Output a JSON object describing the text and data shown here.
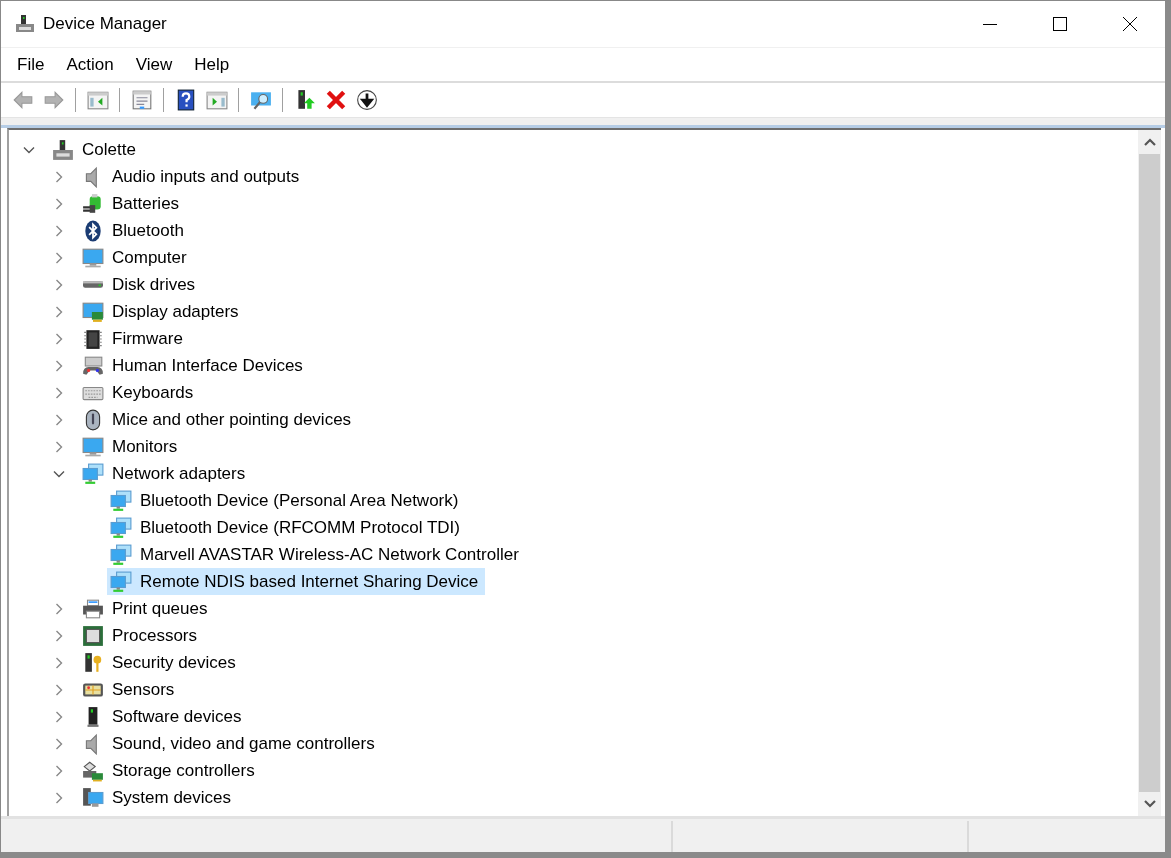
{
  "window": {
    "title": "Device Manager"
  },
  "menu": [
    {
      "label": "File"
    },
    {
      "label": "Action"
    },
    {
      "label": "View"
    },
    {
      "label": "Help"
    }
  ],
  "toolbar": [
    {
      "kind": "back",
      "disabled": true
    },
    {
      "kind": "forward",
      "disabled": true
    },
    {
      "kind": "separator"
    },
    {
      "kind": "console-tree",
      "disabled": false
    },
    {
      "kind": "separator"
    },
    {
      "kind": "properties",
      "disabled": false
    },
    {
      "kind": "separator"
    },
    {
      "kind": "help",
      "disabled": false
    },
    {
      "kind": "action-pane",
      "disabled": false
    },
    {
      "kind": "separator"
    },
    {
      "kind": "scan",
      "disabled": false
    },
    {
      "kind": "separator"
    },
    {
      "kind": "update",
      "disabled": false
    },
    {
      "kind": "uninstall",
      "disabled": false
    },
    {
      "kind": "download",
      "disabled": false
    }
  ],
  "tree": {
    "label": "Colette",
    "kind": "computer-root",
    "expanded": true,
    "selected": false,
    "children": [
      {
        "label": "Audio inputs and outputs",
        "kind": "speaker",
        "expanded": false,
        "selected": false
      },
      {
        "label": "Batteries",
        "kind": "battery",
        "expanded": false,
        "selected": false
      },
      {
        "label": "Bluetooth",
        "kind": "bluetooth",
        "expanded": false,
        "selected": false
      },
      {
        "label": "Computer",
        "kind": "monitor",
        "expanded": false,
        "selected": false
      },
      {
        "label": "Disk drives",
        "kind": "disk",
        "expanded": false,
        "selected": false
      },
      {
        "label": "Display adapters",
        "kind": "display",
        "expanded": false,
        "selected": false
      },
      {
        "label": "Firmware",
        "kind": "chip",
        "expanded": false,
        "selected": false
      },
      {
        "label": "Human Interface Devices",
        "kind": "hid",
        "expanded": false,
        "selected": false
      },
      {
        "label": "Keyboards",
        "kind": "keyboard",
        "expanded": false,
        "selected": false
      },
      {
        "label": "Mice and other pointing devices",
        "kind": "mouse",
        "expanded": false,
        "selected": false
      },
      {
        "label": "Monitors",
        "kind": "monitor",
        "expanded": false,
        "selected": false
      },
      {
        "label": "Network adapters",
        "kind": "network",
        "expanded": true,
        "selected": false,
        "children": [
          {
            "label": "Bluetooth Device (Personal Area Network)",
            "kind": "network",
            "selected": false
          },
          {
            "label": "Bluetooth Device (RFCOMM Protocol TDI)",
            "kind": "network",
            "selected": false
          },
          {
            "label": "Marvell AVASTAR Wireless-AC Network Controller",
            "kind": "network",
            "selected": false
          },
          {
            "label": "Remote NDIS based Internet Sharing Device",
            "kind": "network",
            "selected": true
          }
        ]
      },
      {
        "label": "Print queues",
        "kind": "printer",
        "expanded": false,
        "selected": false
      },
      {
        "label": "Processors",
        "kind": "processor",
        "expanded": false,
        "selected": false
      },
      {
        "label": "Security devices",
        "kind": "security",
        "expanded": false,
        "selected": false
      },
      {
        "label": "Sensors",
        "kind": "sensor",
        "expanded": false,
        "selected": false
      },
      {
        "label": "Software devices",
        "kind": "software",
        "expanded": false,
        "selected": false
      },
      {
        "label": "Sound, video and game controllers",
        "kind": "speaker",
        "expanded": false,
        "selected": false
      },
      {
        "label": "Storage controllers",
        "kind": "storage",
        "expanded": false,
        "selected": false
      },
      {
        "label": "System devices",
        "kind": "system",
        "expanded": false,
        "selected": false
      }
    ]
  }
}
